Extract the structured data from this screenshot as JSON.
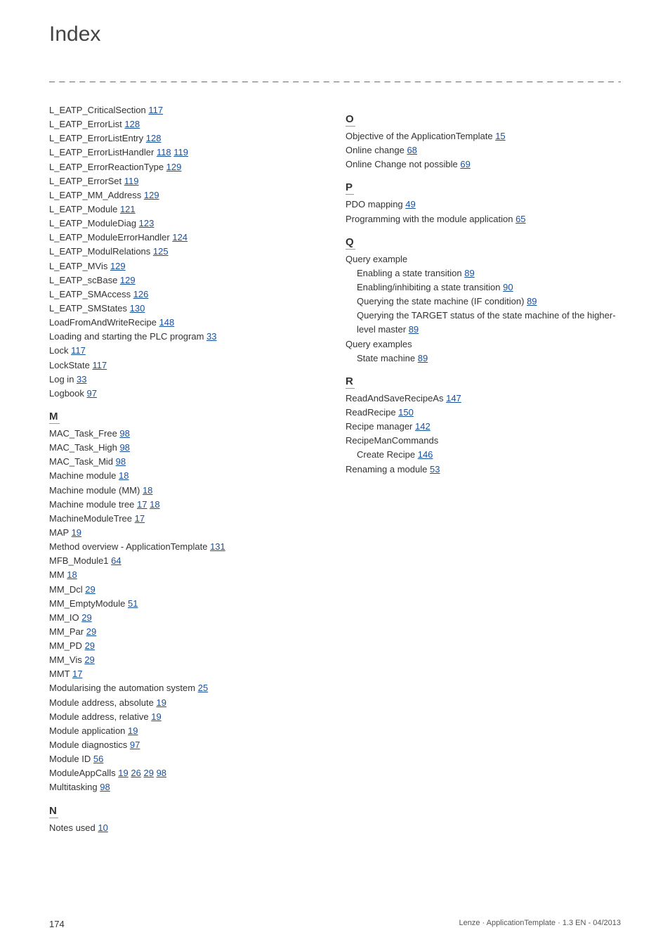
{
  "title": "Index",
  "separator": "_ _ _ _ _ _ _ _ _ _ _ _ _ _ _ _ _ _ _ _ _ _ _ _ _ _ _ _ _ _ _ _ _ _ _ _ _ _ _ _ _ _ _ _ _ _ _ _ _ _ _ _ _ _ _ _ _ _ _ _ _ _ _ _",
  "cols": {
    "left": [
      {
        "t": "entry",
        "label": "L_EATP_CriticalSection",
        "pages": [
          "117"
        ]
      },
      {
        "t": "entry",
        "label": "L_EATP_ErrorList",
        "pages": [
          "128"
        ]
      },
      {
        "t": "entry",
        "label": "L_EATP_ErrorListEntry",
        "pages": [
          "128"
        ]
      },
      {
        "t": "entry",
        "label": "L_EATP_ErrorListHandler",
        "pages": [
          "118",
          "119"
        ]
      },
      {
        "t": "entry",
        "label": "L_EATP_ErrorReactionType",
        "pages": [
          "129"
        ]
      },
      {
        "t": "entry",
        "label": "L_EATP_ErrorSet",
        "pages": [
          "119"
        ]
      },
      {
        "t": "entry",
        "label": "L_EATP_MM_Address",
        "pages": [
          "129"
        ]
      },
      {
        "t": "entry",
        "label": "L_EATP_Module",
        "pages": [
          "121"
        ]
      },
      {
        "t": "entry",
        "label": "L_EATP_ModuleDiag",
        "pages": [
          "123"
        ]
      },
      {
        "t": "entry",
        "label": "L_EATP_ModuleErrorHandler",
        "pages": [
          "124"
        ]
      },
      {
        "t": "entry",
        "label": "L_EATP_ModulRelations",
        "pages": [
          "125"
        ]
      },
      {
        "t": "entry",
        "label": "L_EATP_MVis",
        "pages": [
          "129"
        ]
      },
      {
        "t": "entry",
        "label": "L_EATP_scBase",
        "pages": [
          "129"
        ]
      },
      {
        "t": "entry",
        "label": "L_EATP_SMAccess",
        "pages": [
          "126"
        ]
      },
      {
        "t": "entry",
        "label": "L_EATP_SMStates",
        "pages": [
          "130"
        ]
      },
      {
        "t": "entry",
        "label": "LoadFromAndWriteRecipe",
        "pages": [
          "148"
        ]
      },
      {
        "t": "entry",
        "label": "Loading and starting the PLC program",
        "pages": [
          "33"
        ]
      },
      {
        "t": "entry",
        "label": "Lock",
        "pages": [
          "117"
        ]
      },
      {
        "t": "entry",
        "label": "LockState",
        "pages": [
          "117"
        ]
      },
      {
        "t": "entry",
        "label": "Log in",
        "pages": [
          "33"
        ]
      },
      {
        "t": "entry",
        "label": "Logbook",
        "pages": [
          "97"
        ]
      },
      {
        "t": "heading",
        "label": "M"
      },
      {
        "t": "entry",
        "label": "MAC_Task_Free",
        "pages": [
          "98"
        ]
      },
      {
        "t": "entry",
        "label": "MAC_Task_High",
        "pages": [
          "98"
        ]
      },
      {
        "t": "entry",
        "label": "MAC_Task_Mid",
        "pages": [
          "98"
        ]
      },
      {
        "t": "entry",
        "label": "Machine module",
        "pages": [
          "18"
        ]
      },
      {
        "t": "entry",
        "label": "Machine module (MM)",
        "pages": [
          "18"
        ]
      },
      {
        "t": "entry",
        "label": "Machine module tree",
        "pages": [
          "17",
          "18"
        ]
      },
      {
        "t": "entry",
        "label": "MachineModuleTree",
        "pages": [
          "17"
        ]
      },
      {
        "t": "entry",
        "label": "MAP",
        "pages": [
          "19"
        ]
      },
      {
        "t": "entry",
        "label": "Method overview - ApplicationTemplate",
        "pages": [
          "131"
        ]
      },
      {
        "t": "entry",
        "label": "MFB_Module1",
        "pages": [
          "64"
        ]
      },
      {
        "t": "entry",
        "label": "MM",
        "pages": [
          "18"
        ]
      },
      {
        "t": "entry",
        "label": "MM_Dcl",
        "pages": [
          "29"
        ]
      },
      {
        "t": "entry",
        "label": "MM_EmptyModule",
        "pages": [
          "51"
        ]
      },
      {
        "t": "entry",
        "label": "MM_IO",
        "pages": [
          "29"
        ]
      },
      {
        "t": "entry",
        "label": "MM_Par",
        "pages": [
          "29"
        ]
      },
      {
        "t": "entry",
        "label": "MM_PD",
        "pages": [
          "29"
        ]
      },
      {
        "t": "entry",
        "label": "MM_Vis",
        "pages": [
          "29"
        ]
      },
      {
        "t": "entry",
        "label": "MMT",
        "pages": [
          "17"
        ]
      },
      {
        "t": "entry",
        "label": "Modularising the automation system",
        "pages": [
          "25"
        ]
      },
      {
        "t": "entry",
        "label": "Module address, absolute",
        "pages": [
          "19"
        ]
      },
      {
        "t": "entry",
        "label": "Module address, relative",
        "pages": [
          "19"
        ]
      },
      {
        "t": "entry",
        "label": "Module application",
        "pages": [
          "19"
        ]
      },
      {
        "t": "entry",
        "label": "Module diagnostics",
        "pages": [
          "97"
        ]
      },
      {
        "t": "entry",
        "label": "Module ID",
        "pages": [
          "56"
        ]
      },
      {
        "t": "entry",
        "label": "ModuleAppCalls",
        "pages": [
          "19",
          "26",
          "29",
          "98"
        ]
      },
      {
        "t": "entry",
        "label": "Multitasking",
        "pages": [
          "98"
        ]
      },
      {
        "t": "heading",
        "label": "N"
      },
      {
        "t": "entry",
        "label": "Notes used",
        "pages": [
          "10"
        ]
      }
    ],
    "right": [
      {
        "t": "heading",
        "label": "O"
      },
      {
        "t": "entry",
        "label": "Objective of the ApplicationTemplate",
        "pages": [
          "15"
        ]
      },
      {
        "t": "entry",
        "label": "Online change",
        "pages": [
          "68"
        ]
      },
      {
        "t": "entry",
        "label": "Online Change not possible",
        "pages": [
          "69"
        ]
      },
      {
        "t": "heading",
        "label": "P"
      },
      {
        "t": "entry",
        "label": "PDO mapping",
        "pages": [
          "49"
        ]
      },
      {
        "t": "entry",
        "label": "Programming with the module application",
        "pages": [
          "65"
        ]
      },
      {
        "t": "heading",
        "label": "Q"
      },
      {
        "t": "entry",
        "label": "Query example",
        "pages": []
      },
      {
        "t": "entry",
        "sub": true,
        "label": "Enabling a state transition",
        "pages": [
          "89"
        ]
      },
      {
        "t": "entry",
        "sub": true,
        "label": "Enabling/inhibiting a state transition",
        "pages": [
          "90"
        ]
      },
      {
        "t": "entry",
        "sub": true,
        "label": "Querying the state machine (IF condition)",
        "pages": [
          "89"
        ]
      },
      {
        "t": "entry",
        "sub": true,
        "label": "Querying the TARGET status of the state machine of the higher-level master",
        "pages": [
          "89"
        ]
      },
      {
        "t": "entry",
        "label": "Query examples",
        "pages": []
      },
      {
        "t": "entry",
        "sub": true,
        "label": "State machine",
        "pages": [
          "89"
        ]
      },
      {
        "t": "heading",
        "label": "R"
      },
      {
        "t": "entry",
        "label": "ReadAndSaveRecipeAs",
        "pages": [
          "147"
        ]
      },
      {
        "t": "entry",
        "label": "ReadRecipe",
        "pages": [
          "150"
        ]
      },
      {
        "t": "entry",
        "label": "Recipe manager",
        "pages": [
          "142"
        ]
      },
      {
        "t": "entry",
        "label": "RecipeManCommands",
        "pages": []
      },
      {
        "t": "entry",
        "sub": true,
        "label": "Create Recipe",
        "pages": [
          "146"
        ]
      },
      {
        "t": "entry",
        "label": "Renaming a module",
        "pages": [
          "53"
        ]
      }
    ]
  },
  "footer": {
    "pageno": "174",
    "meta": "Lenze · ApplicationTemplate · 1.3 EN - 04/2013"
  }
}
